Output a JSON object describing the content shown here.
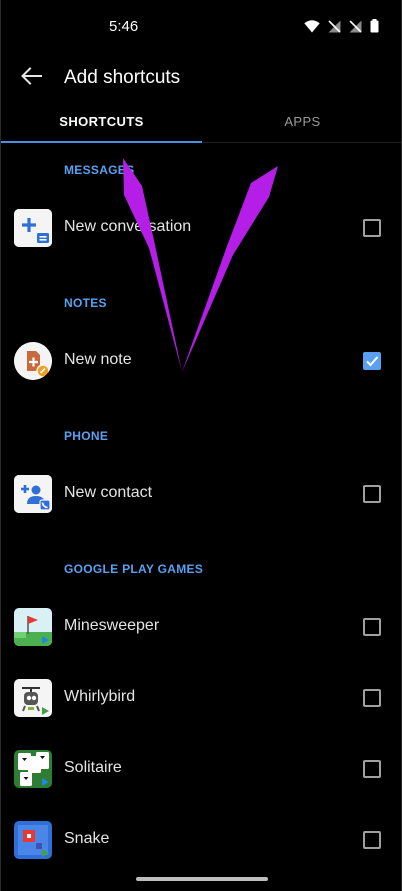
{
  "status_bar": {
    "time": "5:46",
    "icons": [
      "wifi-icon",
      "no-signal-icon",
      "no-signal-icon",
      "battery-icon"
    ]
  },
  "app_bar": {
    "title": "Add shortcuts",
    "back_icon": "arrow-left-icon"
  },
  "tabs": [
    {
      "label": "SHORTCUTS",
      "selected": true
    },
    {
      "label": "APPS",
      "selected": false
    }
  ],
  "sections": [
    {
      "header": "MESSAGES",
      "items": [
        {
          "label": "New conversation",
          "icon": "messages-new-conversation-icon",
          "checked": false
        }
      ]
    },
    {
      "header": "NOTES",
      "items": [
        {
          "label": "New note",
          "icon": "notes-new-note-icon",
          "checked": true
        }
      ]
    },
    {
      "header": "PHONE",
      "items": [
        {
          "label": "New contact",
          "icon": "phone-new-contact-icon",
          "checked": false
        }
      ]
    },
    {
      "header": "GOOGLE PLAY GAMES",
      "items": [
        {
          "label": "Minesweeper",
          "icon": "minesweeper-game-icon",
          "checked": false
        },
        {
          "label": "Whirlybird",
          "icon": "whirlybird-game-icon",
          "checked": false
        },
        {
          "label": "Solitaire",
          "icon": "solitaire-game-icon",
          "checked": false
        },
        {
          "label": "Snake",
          "icon": "snake-game-icon",
          "checked": false
        }
      ]
    }
  ],
  "colors": {
    "accent": "#5aa0f0",
    "tab_indicator": "#4a90e2",
    "annotation_arrow": "#b41ee6",
    "background": "#000000"
  }
}
